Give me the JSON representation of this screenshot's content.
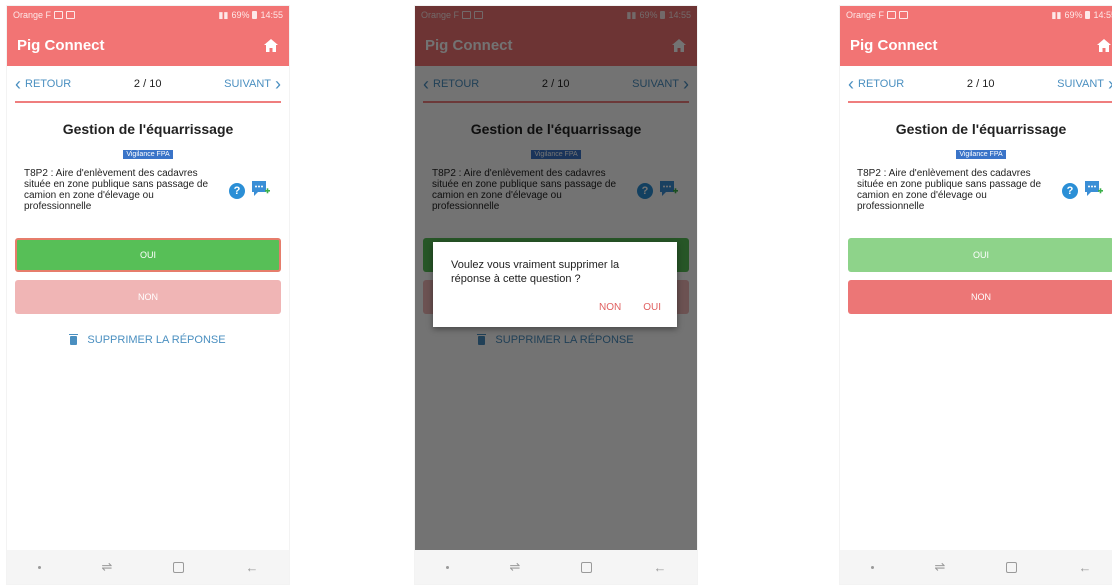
{
  "status": {
    "carrier": "Orange F",
    "battery": "69%",
    "time": "14:55"
  },
  "app": {
    "title": "Pig Connect"
  },
  "nav": {
    "back": "RETOUR",
    "counter": "2 / 10",
    "next": "SUIVANT"
  },
  "question": {
    "title": "Gestion de l'équarrissage",
    "badge": "Vigilance FPA",
    "text": "T8P2 : Aire d'enlèvement des cadavres située en zone publique sans passage de camion en zone d'élevage ou professionnelle"
  },
  "answers": {
    "yes": "OUI",
    "no": "NON"
  },
  "delete_label": "SUPPRIMER LA RÉPONSE",
  "dialog": {
    "message": "Voulez vous vraiment supprimer la réponse à cette question ?",
    "no": "NON",
    "yes": "OUI"
  },
  "icons": {
    "home": "home-icon",
    "help": "help-icon",
    "comment": "add-comment-icon",
    "trash": "trash-icon"
  },
  "colors": {
    "header": "#f27474",
    "link": "#4a8fc0",
    "oui_selected": "#57bf57",
    "non_selected": "#ec7676"
  }
}
